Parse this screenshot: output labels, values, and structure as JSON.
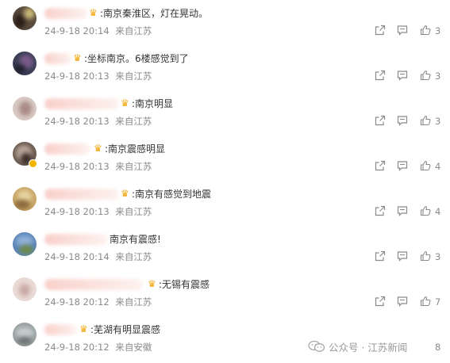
{
  "comments": [
    {
      "text": ":南京秦淮区，灯在晃动。",
      "date": "24-9-18 20:14",
      "location": "来自江苏",
      "likes": "3"
    },
    {
      "text": ":坐标南京。6楼感觉到了",
      "date": "24-9-18 20:13",
      "location": "来自江苏",
      "likes": "3"
    },
    {
      "text": ":南京明显",
      "date": "24-9-18 20:13",
      "location": "来自江苏",
      "likes": "3"
    },
    {
      "text": ":南京震感明显",
      "date": "24-9-18 20:13",
      "location": "来自江苏",
      "likes": "4"
    },
    {
      "text": ":南京有感觉到地震",
      "date": "24-9-18 20:13",
      "location": "来自江苏",
      "likes": "4"
    },
    {
      "text": "南京有震感!",
      "date": "24-9-18 20:14",
      "location": "来自江苏",
      "likes": "3"
    },
    {
      "text": ":无锡有震感",
      "date": "24-9-18 20:12",
      "location": "来自江苏",
      "likes": "7"
    },
    {
      "text": ":芜湖有明显震感",
      "date": "24-9-18 20:12",
      "location": "来自安徽",
      "likes": "8"
    }
  ],
  "watermark": {
    "label": "公众号 · 江苏新闻"
  },
  "colors": {
    "text": "#333333",
    "meta": "#8a8a8a",
    "crown": "#f3a712",
    "name_blur": "#f8c8c2"
  },
  "icons": {
    "share": "share-icon",
    "comment": "comment-icon",
    "like": "thumbs-up-icon",
    "crown": "crown-icon",
    "verified": "verified-badge-icon"
  }
}
